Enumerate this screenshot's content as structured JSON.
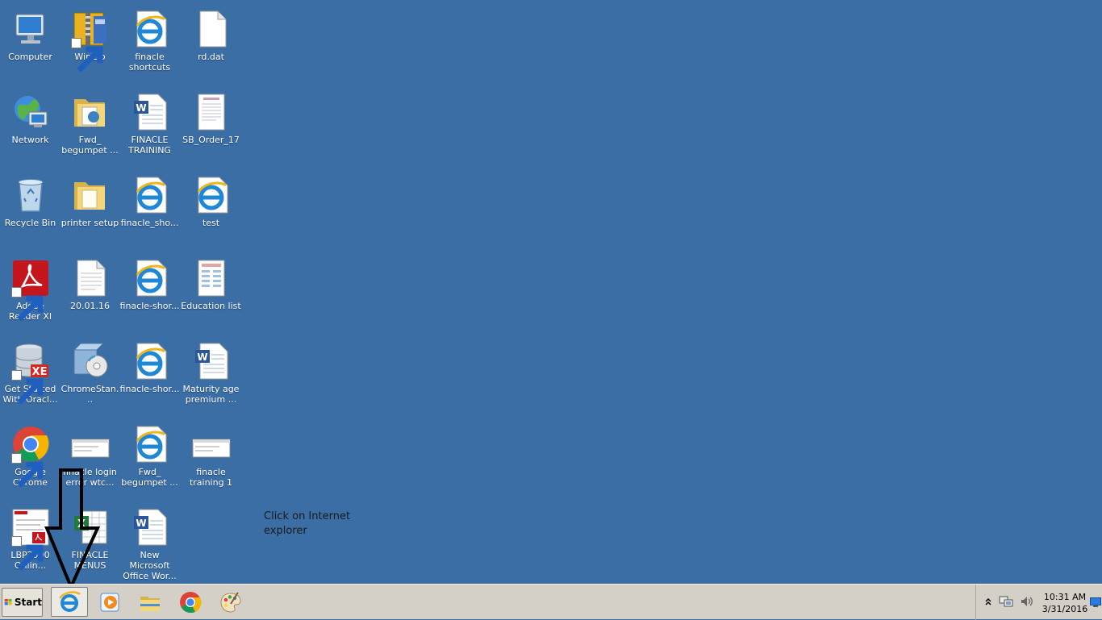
{
  "desktop": {
    "icons": [
      {
        "label": "Computer"
      },
      {
        "label": "Network"
      },
      {
        "label": "Recycle Bin"
      },
      {
        "label": "Adobe Reader XI"
      },
      {
        "label": "Get Started With Oracl..."
      },
      {
        "label": "Google Chrome"
      },
      {
        "label": "LBP2900 Onlin..."
      },
      {
        "label": "WinZip"
      },
      {
        "label": "Fwd_ begumpet ..."
      },
      {
        "label": "printer setup"
      },
      {
        "label": "20.01.16"
      },
      {
        "label": "ChromeStan..."
      },
      {
        "label": "finacle login error wtc..."
      },
      {
        "label": "FINACLE MENUS"
      },
      {
        "label": "finacle shortcuts"
      },
      {
        "label": "FINACLE TRAINING"
      },
      {
        "label": "finacle_sho..."
      },
      {
        "label": "finacle-shor..."
      },
      {
        "label": "finacle-shor..."
      },
      {
        "label": "Fwd_ begumpet ..."
      },
      {
        "label": "New Microsoft Office Wor..."
      },
      {
        "label": "rd.dat"
      },
      {
        "label": "SB_Order_17"
      },
      {
        "label": "test"
      },
      {
        "label": "Education list"
      },
      {
        "label": "Maturity age premium ..."
      },
      {
        "label": "finacle training 1"
      }
    ]
  },
  "annotation": {
    "text": "Click on Internet explorer"
  },
  "taskbar": {
    "start_label": "Start",
    "pinned": [
      {
        "icon": "internet-explorer-icon"
      },
      {
        "icon": "media-player-icon"
      },
      {
        "icon": "file-explorer-icon"
      },
      {
        "icon": "chrome-icon"
      },
      {
        "icon": "paint-icon"
      }
    ],
    "clock": {
      "time": "10:31 AM",
      "date": "3/31/2016"
    }
  },
  "colors": {
    "desktop": "#3a6ea5",
    "taskbar": "#d4d0c8"
  }
}
